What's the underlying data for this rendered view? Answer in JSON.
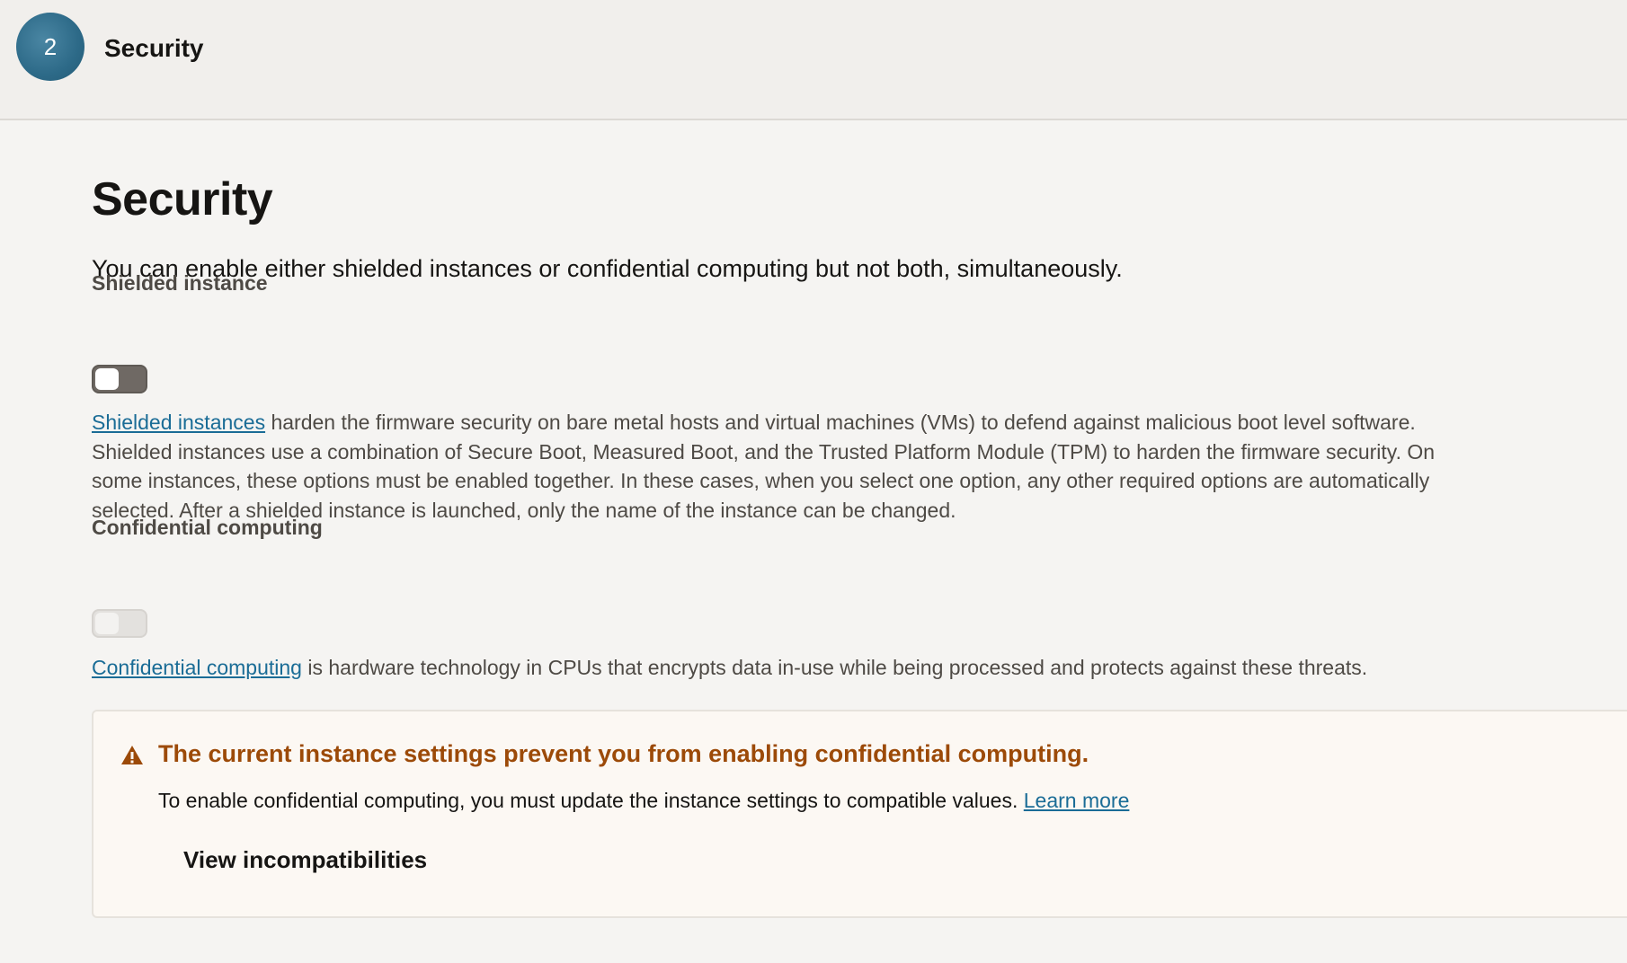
{
  "step": {
    "number": "2",
    "title": "Security"
  },
  "page": {
    "title": "Security",
    "intro": "You can enable either shielded instances or confidential computing but not both, simultaneously."
  },
  "shielded": {
    "label": "Shielded instance",
    "toggle_state": "off",
    "link_text": "Shielded instances",
    "description_line1_rest": " harden the firmware security on bare metal hosts and virtual machines (VMs) to defend against malicious boot level software.",
    "description_line2": "Shielded instances use a combination of Secure Boot, Measured Boot, and the Trusted Platform Module (TPM) to harden the firmware security. On",
    "description_line3": "some instances, these options must be enabled together. In these cases, when you select one option, any other required options are automatically",
    "description_line4": "selected. After a shielded instance is launched, only the name of the instance can be changed."
  },
  "confidential": {
    "label": "Confidential computing",
    "toggle_state": "disabled",
    "link_text": "Confidential computing",
    "description_rest": " is hardware technology in CPUs that encrypts data in-use while being processed and protects against these threats."
  },
  "warning": {
    "icon": "warning-triangle-icon",
    "title": "The current instance settings prevent you from enabling confidential computing.",
    "text": "To enable confidential computing, you must update the instance settings to compatible values. ",
    "learn_more": "Learn more",
    "button_label": "View incompatibilities"
  },
  "colors": {
    "link": "#1a6c96",
    "warning_title": "#9c4a08",
    "badge": "#2d6a88"
  }
}
